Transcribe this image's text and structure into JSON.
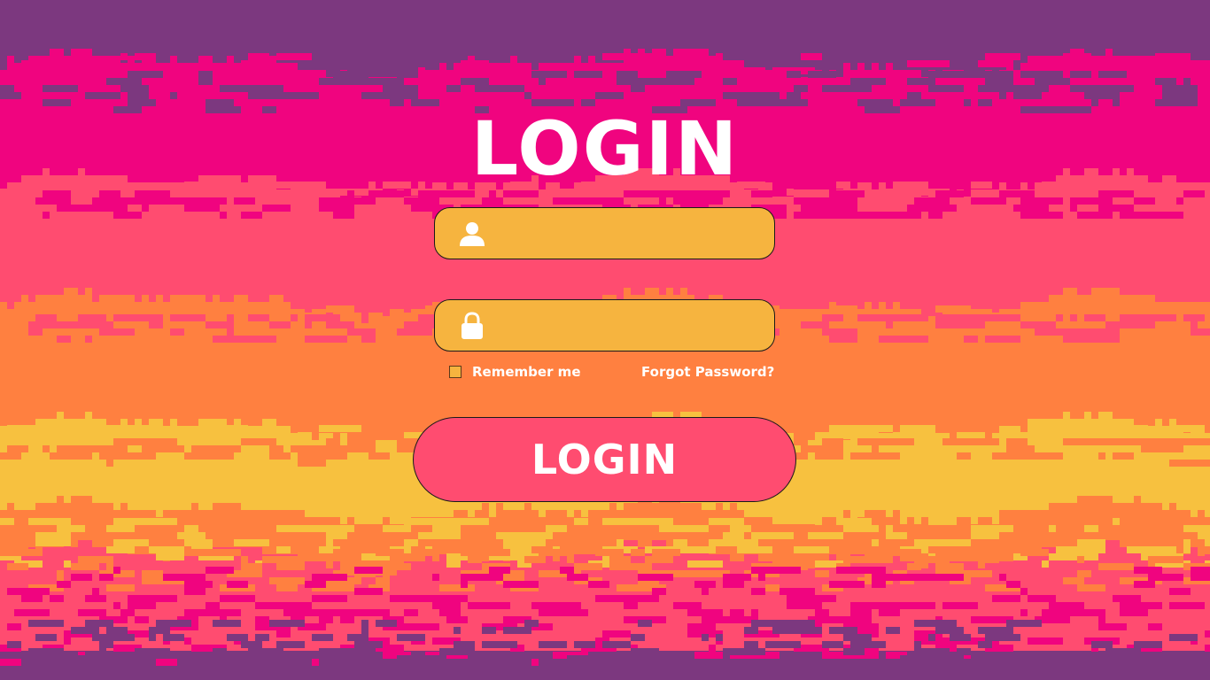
{
  "page": {
    "title": "LOGIN"
  },
  "form": {
    "username_icon": "user-icon",
    "password_icon": "lock-icon",
    "remember_label": "Remember me",
    "remember_checked": false,
    "forgot_label": "Forgot Password?",
    "submit_label": "LOGIN"
  },
  "colors": {
    "top_purple": "#7c387f",
    "magenta": "#f0047f",
    "pink": "#ff4c70",
    "orange": "#ff8040",
    "yellow": "#f7c13f",
    "field_fill": "#f6b43f",
    "button_fill": "#ff4c70",
    "text": "#ffffff"
  }
}
